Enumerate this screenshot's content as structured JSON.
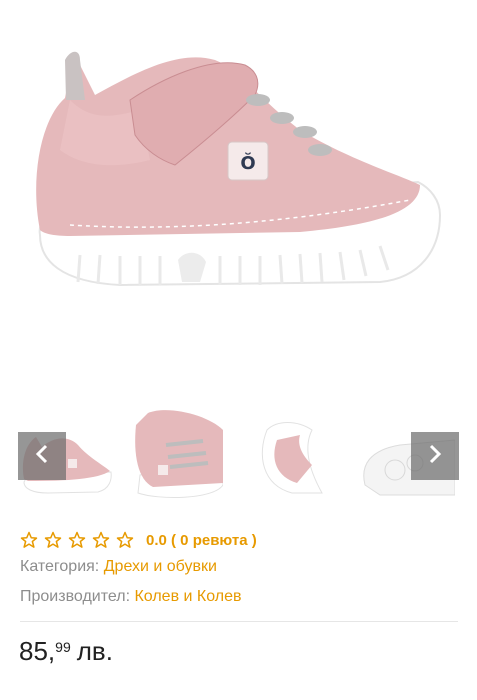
{
  "product": {
    "main_image": "pink-baby-shoe-side-view",
    "thumbnails": [
      {
        "name": "thumb-side"
      },
      {
        "name": "thumb-front"
      },
      {
        "name": "thumb-sole-flex"
      },
      {
        "name": "thumb-sole-bottom"
      }
    ],
    "prev_icon": "chevron-left-icon",
    "next_icon": "chevron-right-icon"
  },
  "rating": {
    "stars_total": 5,
    "stars_filled": 0,
    "text": "0.0 ( 0 ревюта )"
  },
  "meta": {
    "category_label": "Категория:",
    "category_value": "Дрехи и обувки",
    "manufacturer_label": "Производител:",
    "manufacturer_value": "Колев и Колев"
  },
  "price": {
    "whole": "85,",
    "cents": "99",
    "currency": "лв."
  },
  "colors": {
    "accent": "#e79a00",
    "shoe_pink": "#e2b3b5",
    "sole": "#ffffff"
  }
}
